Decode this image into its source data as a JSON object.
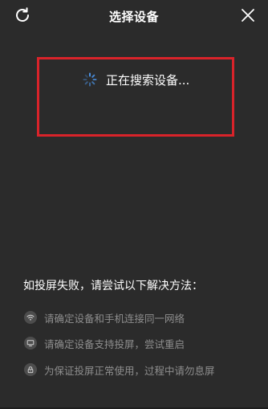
{
  "header": {
    "title": "选择设备",
    "refresh_icon": "refresh-icon",
    "close_icon": "close-icon"
  },
  "status": {
    "searching_text": "正在搜索设备...",
    "spinner_icon": "loading-spinner-icon"
  },
  "tips": {
    "title": "如投屏失败，请尝试以下解决方法：",
    "items": [
      {
        "icon": "wifi-icon",
        "text": "请确定设备和手机连接同一网络"
      },
      {
        "icon": "monitor-icon",
        "text": "请确定设备支持投屏，尝试重启"
      },
      {
        "icon": "lock-icon",
        "text": "为保证投屏正常使用，过程中请勿息屏"
      }
    ]
  },
  "colors": {
    "background": "#2b2b2b",
    "highlight": "#d9232a",
    "tip_text": "#8e8e8e",
    "spinner": "#4a90e2"
  }
}
